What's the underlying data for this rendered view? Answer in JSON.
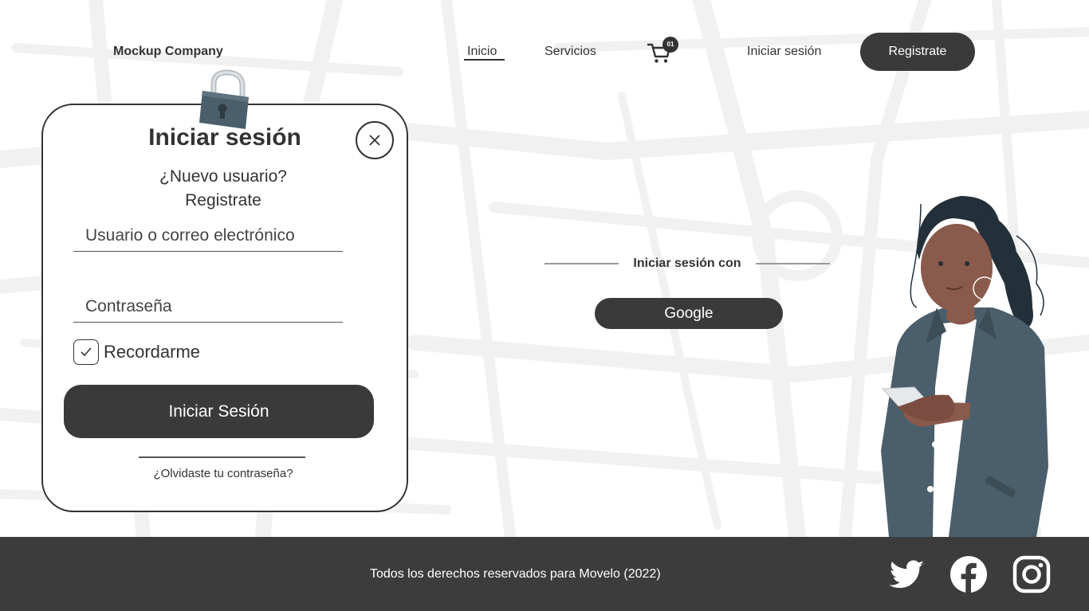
{
  "header": {
    "brand": "Mockup Company",
    "nav": {
      "home": "Inicio",
      "services": "Servicios",
      "login": "Iniciar sesión",
      "register": "Registrate"
    },
    "cart_badge": "01"
  },
  "login_card": {
    "title": "Iniciar sesión",
    "new_user": "¿Nuevo usuario?",
    "register_link": "Registrate",
    "username_placeholder": "Usuario o correo electrónico",
    "password_placeholder": "Contraseña",
    "remember_label": "Recordarme",
    "remember_checked": true,
    "submit_label": "Iniciar Sesión",
    "forgot_label": "¿Olvidaste tu contraseña?"
  },
  "social_login": {
    "heading": "Iniciar sesión con",
    "google_label": "Google"
  },
  "footer": {
    "copyright": "Todos los derechos reservados para Movelo (2022)",
    "social_icons": [
      "twitter-icon",
      "facebook-icon",
      "instagram-icon"
    ]
  },
  "colors": {
    "dark": "#3a3a3a",
    "footer_bg": "#3c3c3c",
    "map_lines": "#f1f1f1",
    "jacket": "#4a5f6b",
    "skin": "#8a5a4c"
  }
}
